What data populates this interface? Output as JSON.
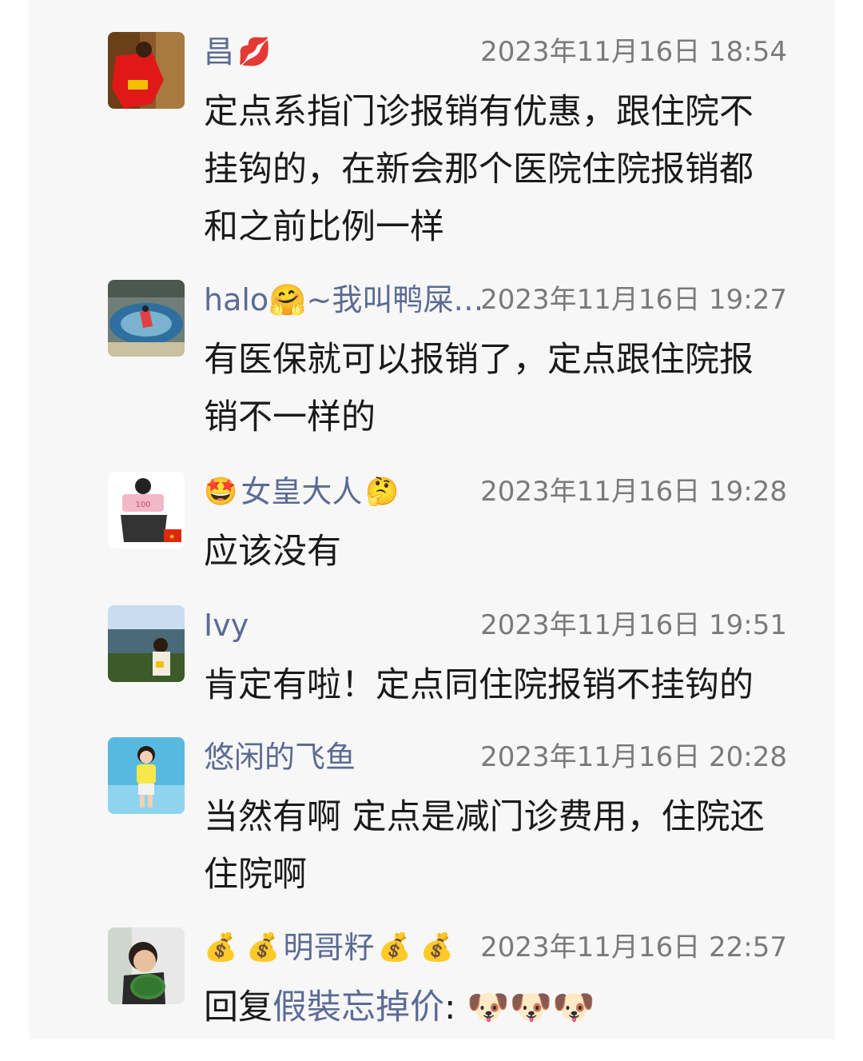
{
  "comments": [
    {
      "name": "昌",
      "name_emoji": "💋",
      "time": "2023年11月16日 18:54",
      "text": "定点系指门诊报销有优惠，跟住院不挂钩的，在新会那个医院住院报销都和之前比例一样"
    },
    {
      "name": "halo🤗~我叫鸭屎…",
      "time": "2023年11月16日 19:27",
      "text": "有医保就可以报销了，定点跟住院报销不一样的"
    },
    {
      "name_prefix": "🤩",
      "name": "女皇大人",
      "name_emoji": "🤔",
      "time": "2023年11月16日 19:28",
      "text": "应该没有"
    },
    {
      "name": "Ivy",
      "time": "2023年11月16日 19:51",
      "text": "肯定有啦！定点同住院报销不挂钩的"
    },
    {
      "name": "悠闲的飞鱼",
      "time": "2023年11月16日 20:28",
      "text": "当然有啊 定点是减门诊费用，住院还住院啊"
    },
    {
      "name_prefix": "💰 💰",
      "name": "明哥籽",
      "name_emoji": "💰 💰",
      "time": "2023年11月16日 22:57",
      "reply_prefix": "回复",
      "reply_to": "假裝忘掉价",
      "reply_colon": ":",
      "reply_emoji": "🐶🐶🐶"
    }
  ],
  "colors": {
    "name": "#5b6b93",
    "time": "#7a7a7a",
    "text": "#1a1a1a",
    "panel_bg": "#f7f7f7"
  }
}
